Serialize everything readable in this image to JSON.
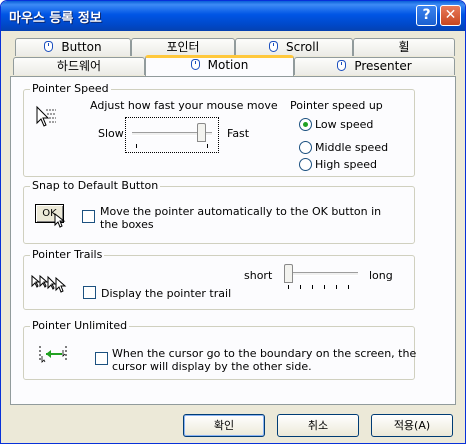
{
  "window": {
    "title": "마우스 등록 정보",
    "help_label": "?",
    "close_label": "✕"
  },
  "tabs_row1": [
    {
      "label": "Button",
      "icon": "mouse-icon"
    },
    {
      "label": "포인터"
    },
    {
      "label": "Scroll",
      "icon": "mouse-icon"
    },
    {
      "label": "휠"
    }
  ],
  "tabs_row2": [
    {
      "label": "하드웨어"
    },
    {
      "label": "Motion",
      "icon": "mouse-icon",
      "active": true
    },
    {
      "label": "Presenter",
      "icon": "mouse-icon"
    }
  ],
  "pointer_speed": {
    "legend": "Pointer Speed",
    "description": "Adjust how fast your mouse move",
    "slow_label": "Slow",
    "fast_label": "Fast",
    "slider_value_fraction": 0.9,
    "speed_up_label": "Pointer speed up",
    "options": [
      "Low speed",
      "Middle speed",
      "High speed"
    ],
    "selected": "Low speed"
  },
  "snap": {
    "legend": "Snap to Default Button",
    "icon_label": "OK",
    "checkbox_label_line1": "Move the pointer automatically to the OK button in",
    "checkbox_label_line2": "the boxes",
    "checked": false
  },
  "trails": {
    "legend": "Pointer Trails",
    "checkbox_label": "Display the pointer trail",
    "checked": false,
    "short_label": "short",
    "long_label": "long",
    "slider_value_fraction": 0.0
  },
  "unlimited": {
    "legend": "Pointer Unlimited",
    "checkbox_label_line1": "When the cursor go to the boundary on the screen, the",
    "checkbox_label_line2": "cursor will display by the other side.",
    "checked": false
  },
  "buttons": {
    "ok": "확인",
    "cancel": "취소",
    "apply": "적용(A)"
  }
}
